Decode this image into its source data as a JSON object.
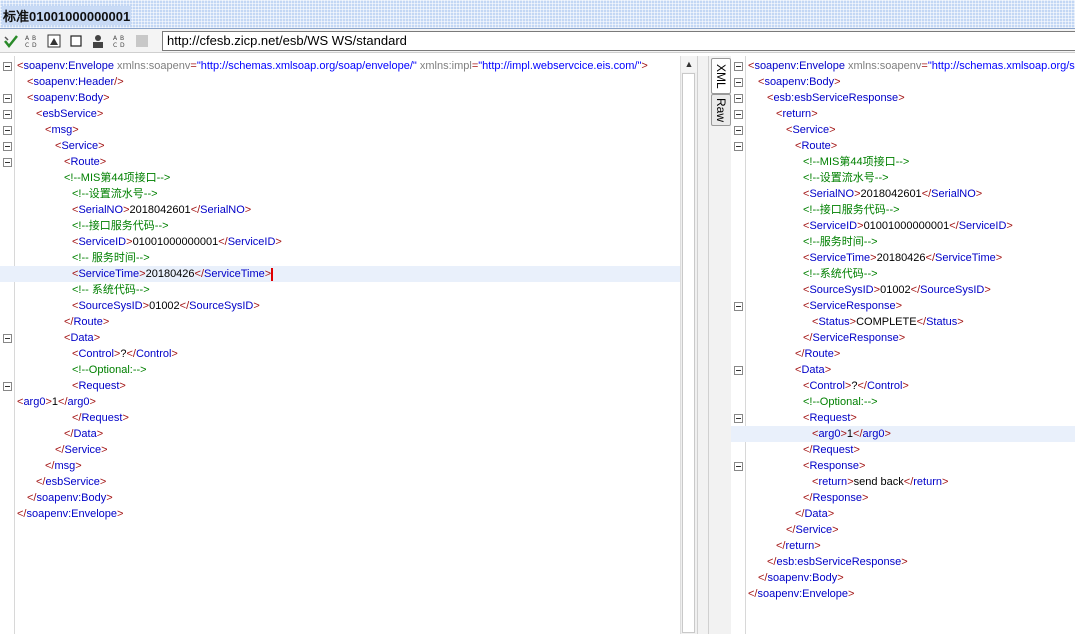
{
  "window": {
    "title": "标准01001000000001"
  },
  "toolbar": {
    "url": "http://cfesb.zicp.net/esb/WS WS/standard",
    "icons": [
      "run-check-icon",
      "format-xml-icon",
      "format-xml-2-icon",
      "image-icon",
      "stop-icon",
      "user-icon",
      "format-xml-3-icon",
      "disabled-icon"
    ]
  },
  "request_lines": [
    {
      "fold": true,
      "indent": 0,
      "parts": [
        [
          "t",
          "<"
        ],
        [
          "n",
          "soapenv:Envelope"
        ],
        [
          "a",
          " xmlns:soapenv"
        ],
        [
          "t",
          "="
        ],
        [
          "v",
          "\"http://schemas.xmlsoap.org/soap/envelope/\""
        ],
        [
          "a",
          " xmlns:impl"
        ],
        [
          "t",
          "="
        ],
        [
          "v",
          "\"http://impl.webservcice.eis.com/\""
        ],
        [
          "t",
          ">"
        ]
      ]
    },
    {
      "fold": false,
      "indent": 10,
      "parts": [
        [
          "t",
          "<"
        ],
        [
          "n",
          "soapenv:Header"
        ],
        [
          "t",
          "/>"
        ]
      ]
    },
    {
      "fold": true,
      "indent": 10,
      "parts": [
        [
          "t",
          "<"
        ],
        [
          "n",
          "soapenv:Body"
        ],
        [
          "t",
          ">"
        ]
      ]
    },
    {
      "fold": true,
      "indent": 19,
      "parts": [
        [
          "t",
          "<"
        ],
        [
          "n",
          "esbService"
        ],
        [
          "t",
          ">"
        ]
      ]
    },
    {
      "fold": true,
      "indent": 28,
      "parts": [
        [
          "t",
          "<"
        ],
        [
          "n",
          "msg"
        ],
        [
          "t",
          ">"
        ]
      ]
    },
    {
      "fold": true,
      "indent": 38,
      "parts": [
        [
          "t",
          "<"
        ],
        [
          "n",
          "Service"
        ],
        [
          "t",
          ">"
        ]
      ]
    },
    {
      "fold": true,
      "indent": 47,
      "parts": [
        [
          "t",
          "<"
        ],
        [
          "n",
          "Route"
        ],
        [
          "t",
          ">"
        ]
      ]
    },
    {
      "fold": false,
      "indent": 47,
      "parts": [
        [
          "c",
          "<!--MIS第44项接口-->"
        ]
      ]
    },
    {
      "fold": false,
      "indent": 55,
      "parts": [
        [
          "c",
          "<!--设置流水号-->"
        ]
      ]
    },
    {
      "fold": false,
      "indent": 55,
      "parts": [
        [
          "t",
          "<"
        ],
        [
          "n",
          "SerialNO"
        ],
        [
          "t",
          ">"
        ],
        [
          "x",
          "2018042601"
        ],
        [
          "t",
          "</"
        ],
        [
          "n",
          "SerialNO"
        ],
        [
          "t",
          ">"
        ]
      ]
    },
    {
      "fold": false,
      "indent": 55,
      "parts": [
        [
          "c",
          "<!--接口服务代码-->"
        ]
      ]
    },
    {
      "fold": false,
      "indent": 55,
      "parts": [
        [
          "t",
          "<"
        ],
        [
          "n",
          "ServiceID"
        ],
        [
          "t",
          ">"
        ],
        [
          "x",
          "01001000000001"
        ],
        [
          "t",
          "</"
        ],
        [
          "n",
          "ServiceID"
        ],
        [
          "t",
          ">"
        ]
      ]
    },
    {
      "fold": false,
      "indent": 55,
      "parts": [
        [
          "c",
          "<!-- 服务时间-->"
        ]
      ]
    },
    {
      "fold": false,
      "indent": 55,
      "hl": true,
      "caret": true,
      "parts": [
        [
          "t",
          "<"
        ],
        [
          "n",
          "ServiceTime"
        ],
        [
          "t",
          ">"
        ],
        [
          "x",
          "20180426"
        ],
        [
          "t",
          "</"
        ],
        [
          "n",
          "ServiceTime"
        ],
        [
          "t",
          ">"
        ]
      ]
    },
    {
      "fold": false,
      "indent": 55,
      "parts": [
        [
          "c",
          "<!-- 系统代码-->"
        ]
      ]
    },
    {
      "fold": false,
      "indent": 55,
      "parts": [
        [
          "t",
          "<"
        ],
        [
          "n",
          "SourceSysID"
        ],
        [
          "t",
          ">"
        ],
        [
          "x",
          "01002"
        ],
        [
          "t",
          "</"
        ],
        [
          "n",
          "SourceSysID"
        ],
        [
          "t",
          ">"
        ]
      ]
    },
    {
      "fold": false,
      "indent": 47,
      "parts": [
        [
          "t",
          "</"
        ],
        [
          "n",
          "Route"
        ],
        [
          "t",
          ">"
        ]
      ]
    },
    {
      "fold": true,
      "indent": 47,
      "parts": [
        [
          "t",
          "<"
        ],
        [
          "n",
          "Data"
        ],
        [
          "t",
          ">"
        ]
      ]
    },
    {
      "fold": false,
      "indent": 55,
      "parts": [
        [
          "t",
          "<"
        ],
        [
          "n",
          "Control"
        ],
        [
          "t",
          ">"
        ],
        [
          "x",
          "?"
        ],
        [
          "t",
          "</"
        ],
        [
          "n",
          "Control"
        ],
        [
          "t",
          ">"
        ]
      ]
    },
    {
      "fold": false,
      "indent": 55,
      "parts": [
        [
          "c",
          "<!--Optional:-->"
        ]
      ]
    },
    {
      "fold": true,
      "indent": 55,
      "parts": [
        [
          "t",
          "<"
        ],
        [
          "n",
          "Request"
        ],
        [
          "t",
          ">"
        ]
      ]
    },
    {
      "fold": false,
      "indent": 0,
      "parts": [
        [
          "t",
          "<"
        ],
        [
          "n",
          "arg0"
        ],
        [
          "t",
          ">"
        ],
        [
          "x",
          "1"
        ],
        [
          "t",
          "</"
        ],
        [
          "n",
          "arg0"
        ],
        [
          "t",
          ">"
        ]
      ]
    },
    {
      "fold": false,
      "indent": 55,
      "parts": [
        [
          "t",
          "</"
        ],
        [
          "n",
          "Request"
        ],
        [
          "t",
          ">"
        ]
      ]
    },
    {
      "fold": false,
      "indent": 47,
      "parts": [
        [
          "t",
          "</"
        ],
        [
          "n",
          "Data"
        ],
        [
          "t",
          ">"
        ]
      ]
    },
    {
      "fold": false,
      "indent": 38,
      "parts": [
        [
          "t",
          "</"
        ],
        [
          "n",
          "Service"
        ],
        [
          "t",
          ">"
        ]
      ]
    },
    {
      "fold": false,
      "indent": 28,
      "parts": [
        [
          "t",
          "</"
        ],
        [
          "n",
          "msg"
        ],
        [
          "t",
          ">"
        ]
      ]
    },
    {
      "fold": false,
      "indent": 19,
      "parts": [
        [
          "t",
          "</"
        ],
        [
          "n",
          "esbService"
        ],
        [
          "t",
          ">"
        ]
      ]
    },
    {
      "fold": false,
      "indent": 10,
      "parts": [
        [
          "t",
          "</"
        ],
        [
          "n",
          "soapenv:Body"
        ],
        [
          "t",
          ">"
        ]
      ]
    },
    {
      "fold": false,
      "indent": 0,
      "parts": [
        [
          "t",
          "</"
        ],
        [
          "n",
          "soapenv:Envelope"
        ],
        [
          "t",
          ">"
        ]
      ]
    }
  ],
  "response_lines": [
    {
      "fold": true,
      "indent": 0,
      "parts": [
        [
          "t",
          "<"
        ],
        [
          "n",
          "soapenv:Envelope"
        ],
        [
          "a",
          " xmlns:soapenv"
        ],
        [
          "t",
          "="
        ],
        [
          "v",
          "\"http://schemas.xmlsoap.org/s"
        ]
      ]
    },
    {
      "fold": true,
      "indent": 10,
      "parts": [
        [
          "t",
          "<"
        ],
        [
          "n",
          "soapenv:Body"
        ],
        [
          "t",
          ">"
        ]
      ]
    },
    {
      "fold": true,
      "indent": 19,
      "parts": [
        [
          "t",
          "<"
        ],
        [
          "n",
          "esb:esbServiceResponse"
        ],
        [
          "t",
          ">"
        ]
      ]
    },
    {
      "fold": true,
      "indent": 28,
      "parts": [
        [
          "t",
          "<"
        ],
        [
          "n",
          "return"
        ],
        [
          "t",
          ">"
        ]
      ]
    },
    {
      "fold": true,
      "indent": 38,
      "parts": [
        [
          "t",
          "<"
        ],
        [
          "n",
          "Service"
        ],
        [
          "t",
          ">"
        ]
      ]
    },
    {
      "fold": true,
      "indent": 47,
      "parts": [
        [
          "t",
          "<"
        ],
        [
          "n",
          "Route"
        ],
        [
          "t",
          ">"
        ]
      ]
    },
    {
      "fold": false,
      "indent": 55,
      "parts": [
        [
          "c",
          "<!--MIS第44项接口-->"
        ]
      ]
    },
    {
      "fold": false,
      "indent": 55,
      "parts": [
        [
          "c",
          "<!--设置流水号-->"
        ]
      ]
    },
    {
      "fold": false,
      "indent": 55,
      "parts": [
        [
          "t",
          "<"
        ],
        [
          "n",
          "SerialNO"
        ],
        [
          "t",
          ">"
        ],
        [
          "x",
          "2018042601"
        ],
        [
          "t",
          "</"
        ],
        [
          "n",
          "SerialNO"
        ],
        [
          "t",
          ">"
        ]
      ]
    },
    {
      "fold": false,
      "indent": 55,
      "parts": [
        [
          "c",
          "<!--接口服务代码-->"
        ]
      ]
    },
    {
      "fold": false,
      "indent": 55,
      "parts": [
        [
          "t",
          "<"
        ],
        [
          "n",
          "ServiceID"
        ],
        [
          "t",
          ">"
        ],
        [
          "x",
          "01001000000001"
        ],
        [
          "t",
          "</"
        ],
        [
          "n",
          "ServiceID"
        ],
        [
          "t",
          ">"
        ]
      ]
    },
    {
      "fold": false,
      "indent": 55,
      "parts": [
        [
          "c",
          "<!--服务时间-->"
        ]
      ]
    },
    {
      "fold": false,
      "indent": 55,
      "parts": [
        [
          "t",
          "<"
        ],
        [
          "n",
          "ServiceTime"
        ],
        [
          "t",
          ">"
        ],
        [
          "x",
          "20180426"
        ],
        [
          "t",
          "</"
        ],
        [
          "n",
          "ServiceTime"
        ],
        [
          "t",
          ">"
        ]
      ]
    },
    {
      "fold": false,
      "indent": 55,
      "parts": [
        [
          "c",
          "<!--系统代码-->"
        ]
      ]
    },
    {
      "fold": false,
      "indent": 55,
      "parts": [
        [
          "t",
          "<"
        ],
        [
          "n",
          "SourceSysID"
        ],
        [
          "t",
          ">"
        ],
        [
          "x",
          "01002"
        ],
        [
          "t",
          "</"
        ],
        [
          "n",
          "SourceSysID"
        ],
        [
          "t",
          ">"
        ]
      ]
    },
    {
      "fold": true,
      "indent": 55,
      "parts": [
        [
          "t",
          "<"
        ],
        [
          "n",
          "ServiceResponse"
        ],
        [
          "t",
          ">"
        ]
      ]
    },
    {
      "fold": false,
      "indent": 64,
      "parts": [
        [
          "t",
          "<"
        ],
        [
          "n",
          "Status"
        ],
        [
          "t",
          ">"
        ],
        [
          "x",
          "COMPLETE"
        ],
        [
          "t",
          "</"
        ],
        [
          "n",
          "Status"
        ],
        [
          "t",
          ">"
        ]
      ]
    },
    {
      "fold": false,
      "indent": 55,
      "parts": [
        [
          "t",
          "</"
        ],
        [
          "n",
          "ServiceResponse"
        ],
        [
          "t",
          ">"
        ]
      ]
    },
    {
      "fold": false,
      "indent": 47,
      "parts": [
        [
          "t",
          "</"
        ],
        [
          "n",
          "Route"
        ],
        [
          "t",
          ">"
        ]
      ]
    },
    {
      "fold": true,
      "indent": 47,
      "parts": [
        [
          "t",
          "<"
        ],
        [
          "n",
          "Data"
        ],
        [
          "t",
          ">"
        ]
      ]
    },
    {
      "fold": false,
      "indent": 55,
      "parts": [
        [
          "t",
          "<"
        ],
        [
          "n",
          "Control"
        ],
        [
          "t",
          ">"
        ],
        [
          "x",
          "?"
        ],
        [
          "t",
          "</"
        ],
        [
          "n",
          "Control"
        ],
        [
          "t",
          ">"
        ]
      ]
    },
    {
      "fold": false,
      "indent": 55,
      "parts": [
        [
          "c",
          "<!--Optional:-->"
        ]
      ]
    },
    {
      "fold": true,
      "indent": 55,
      "parts": [
        [
          "t",
          "<"
        ],
        [
          "n",
          "Request"
        ],
        [
          "t",
          ">"
        ]
      ]
    },
    {
      "fold": false,
      "indent": 64,
      "hl": true,
      "parts": [
        [
          "t",
          "<"
        ],
        [
          "n",
          "arg0"
        ],
        [
          "t",
          ">"
        ],
        [
          "x",
          "1"
        ],
        [
          "t",
          "</"
        ],
        [
          "n",
          "arg0"
        ],
        [
          "t",
          ">"
        ]
      ]
    },
    {
      "fold": false,
      "indent": 55,
      "parts": [
        [
          "t",
          "</"
        ],
        [
          "n",
          "Request"
        ],
        [
          "t",
          ">"
        ]
      ]
    },
    {
      "fold": true,
      "indent": 55,
      "parts": [
        [
          "t",
          "<"
        ],
        [
          "n",
          "Response"
        ],
        [
          "t",
          ">"
        ]
      ]
    },
    {
      "fold": false,
      "indent": 64,
      "parts": [
        [
          "t",
          "<"
        ],
        [
          "n",
          "return"
        ],
        [
          "t",
          ">"
        ],
        [
          "x",
          "send back"
        ],
        [
          "t",
          "</"
        ],
        [
          "n",
          "return"
        ],
        [
          "t",
          ">"
        ]
      ]
    },
    {
      "fold": false,
      "indent": 55,
      "parts": [
        [
          "t",
          "</"
        ],
        [
          "n",
          "Response"
        ],
        [
          "t",
          ">"
        ]
      ]
    },
    {
      "fold": false,
      "indent": 47,
      "parts": [
        [
          "t",
          "</"
        ],
        [
          "n",
          "Data"
        ],
        [
          "t",
          ">"
        ]
      ]
    },
    {
      "fold": false,
      "indent": 38,
      "parts": [
        [
          "t",
          "</"
        ],
        [
          "n",
          "Service"
        ],
        [
          "t",
          ">"
        ]
      ]
    },
    {
      "fold": false,
      "indent": 28,
      "parts": [
        [
          "t",
          "</"
        ],
        [
          "n",
          "return"
        ],
        [
          "t",
          ">"
        ]
      ]
    },
    {
      "fold": false,
      "indent": 19,
      "parts": [
        [
          "t",
          "</"
        ],
        [
          "n",
          "esb:esbServiceResponse"
        ],
        [
          "t",
          ">"
        ]
      ]
    },
    {
      "fold": false,
      "indent": 10,
      "parts": [
        [
          "t",
          "</"
        ],
        [
          "n",
          "soapenv:Body"
        ],
        [
          "t",
          ">"
        ]
      ]
    },
    {
      "fold": false,
      "indent": 0,
      "parts": [
        [
          "t",
          "</"
        ],
        [
          "n",
          "soapenv:Envelope"
        ],
        [
          "t",
          ">"
        ]
      ]
    }
  ],
  "tabs": {
    "xml_label": "XML",
    "raw_label": "Raw"
  },
  "colors": {
    "tag": "#a31515",
    "name": "#0000c8",
    "attr": "#7f7f7f",
    "value": "#0000ff",
    "comment": "#008000",
    "caret": "#e00000"
  }
}
